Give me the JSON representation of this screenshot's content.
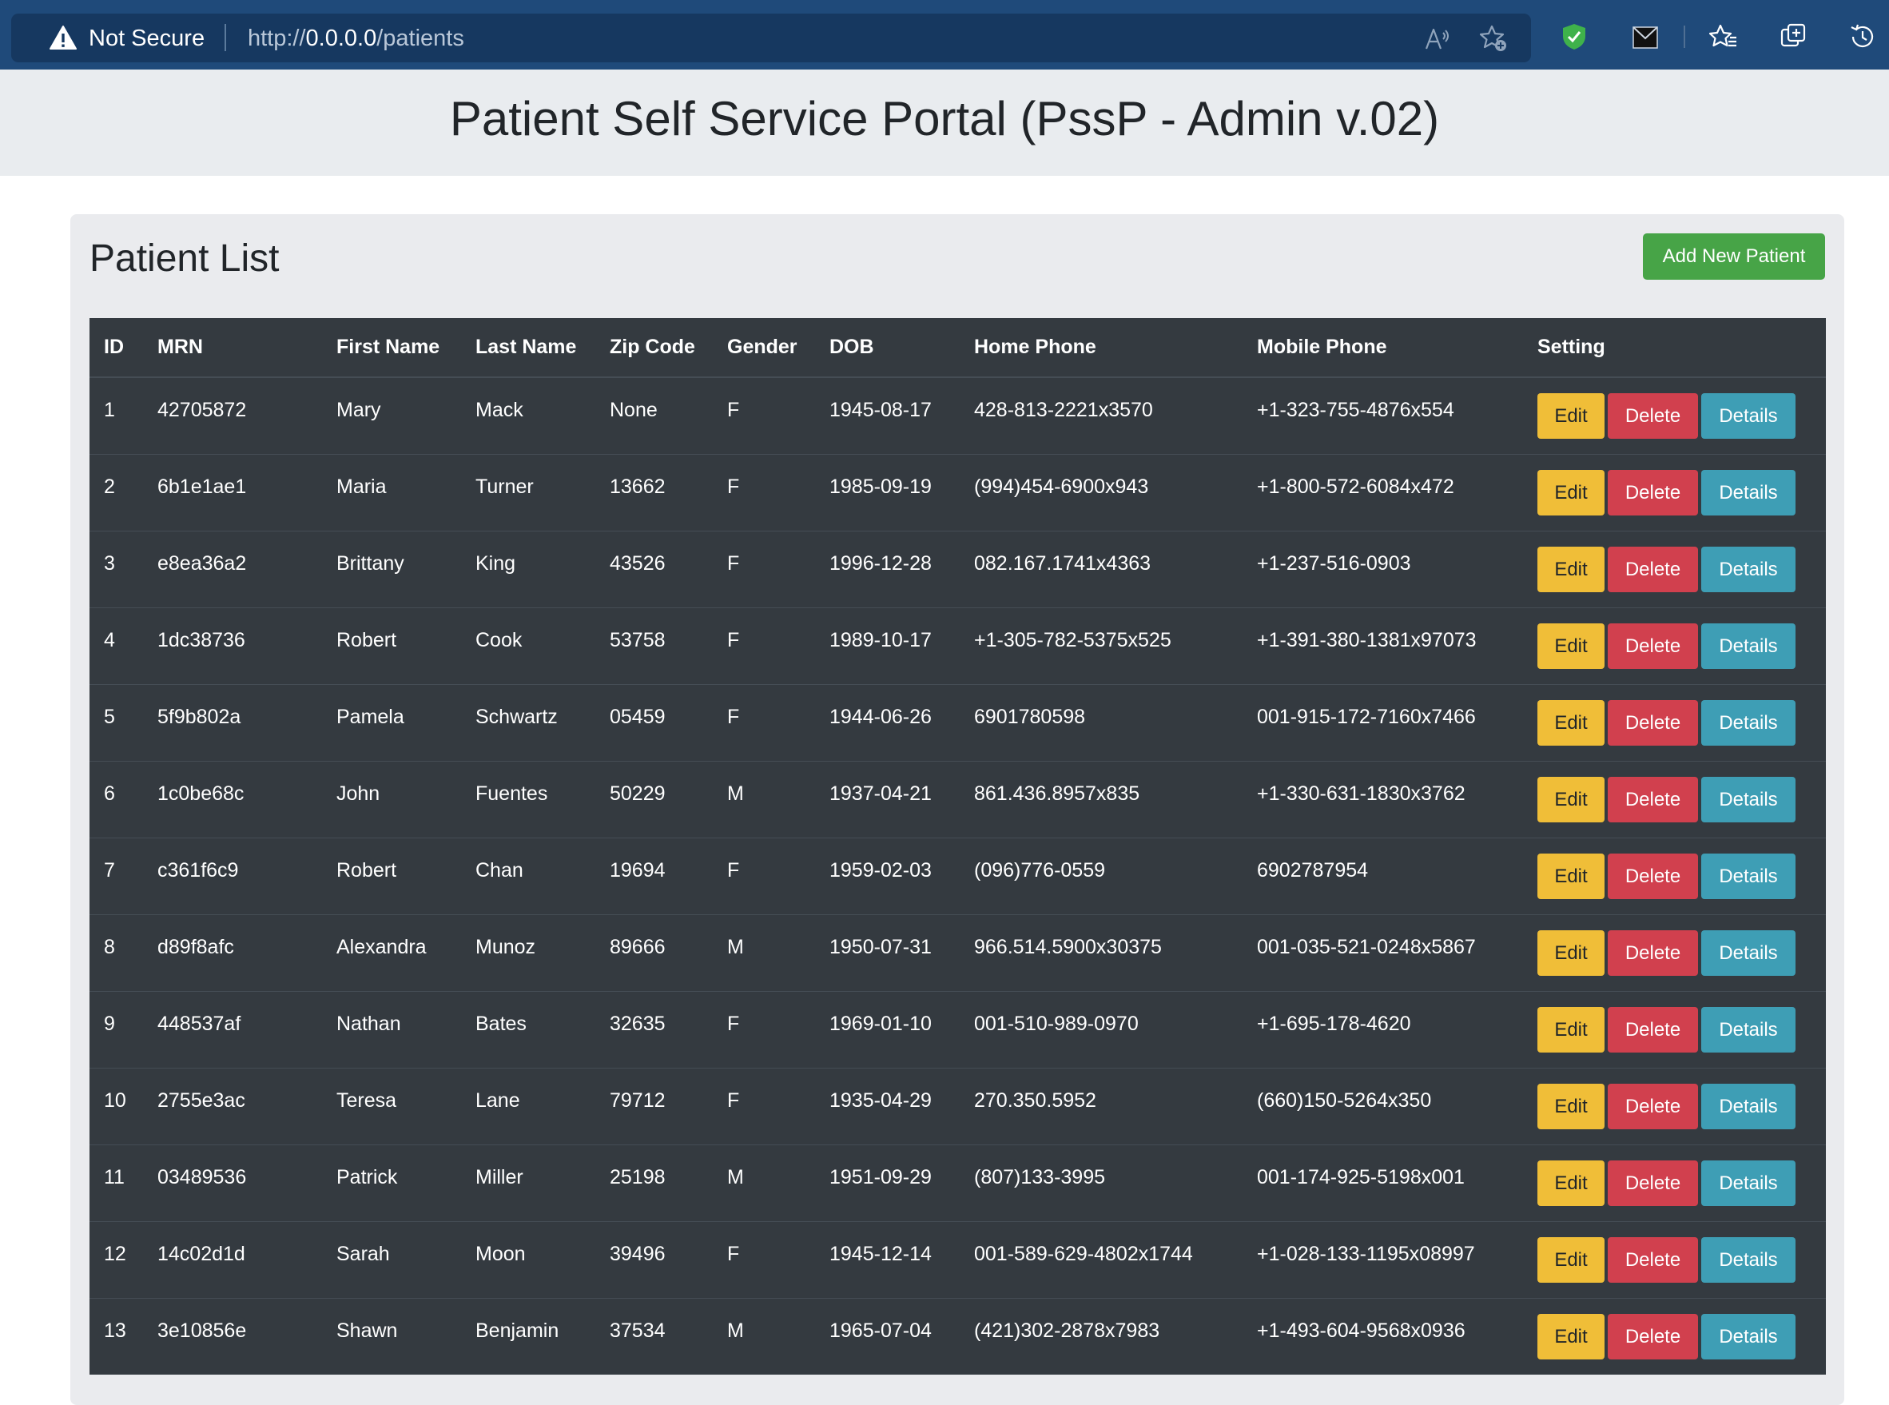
{
  "browser": {
    "security_label": "Not Secure",
    "url_scheme": "http://",
    "url_host": "0.0.0.0",
    "url_path": "/patients"
  },
  "header": {
    "title": "Patient Self Service Portal (PssP - Admin v.02)"
  },
  "card": {
    "title": "Patient List",
    "add_button_label": "Add New Patient"
  },
  "table": {
    "columns": [
      "ID",
      "MRN",
      "First Name",
      "Last Name",
      "Zip Code",
      "Gender",
      "DOB",
      "Home Phone",
      "Mobile Phone",
      "Setting"
    ],
    "rows": [
      [
        "1",
        "42705872",
        "Mary",
        "Mack",
        "None",
        "F",
        "1945-08-17",
        "428-813-2221x3570",
        "+1-323-755-4876x554"
      ],
      [
        "2",
        "6b1e1ae1",
        "Maria",
        "Turner",
        "13662",
        "F",
        "1985-09-19",
        "(994)454-6900x943",
        "+1-800-572-6084x472"
      ],
      [
        "3",
        "e8ea36a2",
        "Brittany",
        "King",
        "43526",
        "F",
        "1996-12-28",
        "082.167.1741x4363",
        "+1-237-516-0903"
      ],
      [
        "4",
        "1dc38736",
        "Robert",
        "Cook",
        "53758",
        "F",
        "1989-10-17",
        "+1-305-782-5375x525",
        "+1-391-380-1381x97073"
      ],
      [
        "5",
        "5f9b802a",
        "Pamela",
        "Schwartz",
        "05459",
        "F",
        "1944-06-26",
        "6901780598",
        "001-915-172-7160x7466"
      ],
      [
        "6",
        "1c0be68c",
        "John",
        "Fuentes",
        "50229",
        "M",
        "1937-04-21",
        "861.436.8957x835",
        "+1-330-631-1830x3762"
      ],
      [
        "7",
        "c361f6c9",
        "Robert",
        "Chan",
        "19694",
        "F",
        "1959-02-03",
        "(096)776-0559",
        "6902787954"
      ],
      [
        "8",
        "d89f8afc",
        "Alexandra",
        "Munoz",
        "89666",
        "M",
        "1950-07-31",
        "966.514.5900x30375",
        "001-035-521-0248x5867"
      ],
      [
        "9",
        "448537af",
        "Nathan",
        "Bates",
        "32635",
        "F",
        "1969-01-10",
        "001-510-989-0970",
        "+1-695-178-4620"
      ],
      [
        "10",
        "2755e3ac",
        "Teresa",
        "Lane",
        "79712",
        "F",
        "1935-04-29",
        "270.350.5952",
        "(660)150-5264x350"
      ],
      [
        "11",
        "03489536",
        "Patrick",
        "Miller",
        "25198",
        "M",
        "1951-09-29",
        "(807)133-3995",
        "001-174-925-5198x001"
      ],
      [
        "12",
        "14c02d1d",
        "Sarah",
        "Moon",
        "39496",
        "F",
        "1945-12-14",
        "001-589-629-4802x1744",
        "+1-028-133-1195x08997"
      ],
      [
        "13",
        "3e10856e",
        "Shawn",
        "Benjamin",
        "37534",
        "M",
        "1965-07-04",
        "(421)302-2878x7983",
        "+1-493-604-9568x0936"
      ]
    ],
    "actions": {
      "edit": "Edit",
      "delete": "Delete",
      "details": "Details"
    }
  },
  "icons": {
    "security": "warning-icon",
    "read_aloud": "read-aloud-icon",
    "add_favorite": "add-favorite-icon",
    "shield_extension": "shield-extension-icon",
    "mail_extension": "mail-extension-icon",
    "favorites": "favorites-icon",
    "collections": "collections-icon",
    "history": "history-icon"
  },
  "colors": {
    "browser_bar": "#1f4a7a",
    "address_box": "#163860",
    "header_bg": "#e9ecef",
    "card_bg": "#eaebee",
    "table_bg": "#343a40",
    "success": "#47a447",
    "warning": "#f0be38",
    "danger": "#d1404e",
    "info": "#3e9eb5"
  }
}
